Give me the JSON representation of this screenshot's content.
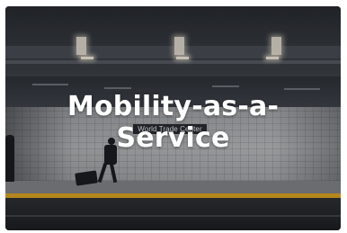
{
  "hero": {
    "title_line1": "Mobility-as-a-",
    "title_line2": "Service",
    "station_sign": "World Trade Center"
  },
  "colors": {
    "platform_stripe": "#d7a21d",
    "title_text": "#ffffff"
  }
}
